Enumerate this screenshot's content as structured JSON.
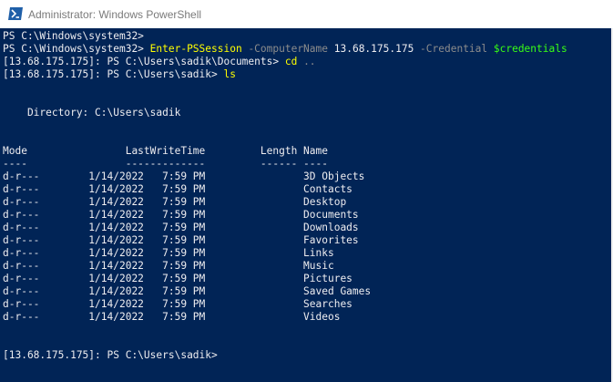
{
  "window": {
    "title": "Administrator: Windows PowerShell"
  },
  "console": {
    "lines": [
      {
        "segments": [
          {
            "text": "PS C:\\Windows\\system32>",
            "color": "white"
          }
        ]
      },
      {
        "segments": [
          {
            "text": "PS C:\\Windows\\system32> ",
            "color": "white"
          },
          {
            "text": "Enter-PSSession",
            "color": "yellow"
          },
          {
            "text": " -ComputerName ",
            "color": "gray"
          },
          {
            "text": "13.68.175.175",
            "color": "white"
          },
          {
            "text": " -Credential ",
            "color": "gray"
          },
          {
            "text": "$credentials",
            "color": "green"
          }
        ]
      },
      {
        "segments": [
          {
            "text": "[13.68.175.175]: PS C:\\Users\\sadik\\Documents> ",
            "color": "white"
          },
          {
            "text": "cd",
            "color": "yellow"
          },
          {
            "text": " ..",
            "color": "gray"
          }
        ]
      },
      {
        "segments": [
          {
            "text": "[13.68.175.175]: PS C:\\Users\\sadik> ",
            "color": "white"
          },
          {
            "text": "ls",
            "color": "yellow"
          }
        ]
      },
      {
        "segments": []
      },
      {
        "segments": []
      },
      {
        "segments": [
          {
            "text": "    Directory: C:\\Users\\sadik",
            "color": "white"
          }
        ]
      },
      {
        "segments": []
      },
      {
        "segments": []
      },
      {
        "segments": [
          {
            "text": "Mode                LastWriteTime         Length Name",
            "color": "white"
          }
        ]
      },
      {
        "segments": [
          {
            "text": "----                -------------         ------ ----",
            "color": "white"
          }
        ]
      },
      {
        "segments": [
          {
            "text": "d-r---        1/14/2022   7:59 PM                3D Objects",
            "color": "white"
          }
        ]
      },
      {
        "segments": [
          {
            "text": "d-r---        1/14/2022   7:59 PM                Contacts",
            "color": "white"
          }
        ]
      },
      {
        "segments": [
          {
            "text": "d-r---        1/14/2022   7:59 PM                Desktop",
            "color": "white"
          }
        ]
      },
      {
        "segments": [
          {
            "text": "d-r---        1/14/2022   7:59 PM                Documents",
            "color": "white"
          }
        ]
      },
      {
        "segments": [
          {
            "text": "d-r---        1/14/2022   7:59 PM                Downloads",
            "color": "white"
          }
        ]
      },
      {
        "segments": [
          {
            "text": "d-r---        1/14/2022   7:59 PM                Favorites",
            "color": "white"
          }
        ]
      },
      {
        "segments": [
          {
            "text": "d-r---        1/14/2022   7:59 PM                Links",
            "color": "white"
          }
        ]
      },
      {
        "segments": [
          {
            "text": "d-r---        1/14/2022   7:59 PM                Music",
            "color": "white"
          }
        ]
      },
      {
        "segments": [
          {
            "text": "d-r---        1/14/2022   7:59 PM                Pictures",
            "color": "white"
          }
        ]
      },
      {
        "segments": [
          {
            "text": "d-r---        1/14/2022   7:59 PM                Saved Games",
            "color": "white"
          }
        ]
      },
      {
        "segments": [
          {
            "text": "d-r---        1/14/2022   7:59 PM                Searches",
            "color": "white"
          }
        ]
      },
      {
        "segments": [
          {
            "text": "d-r---        1/14/2022   7:59 PM                Videos",
            "color": "white"
          }
        ]
      },
      {
        "segments": []
      },
      {
        "segments": []
      },
      {
        "segments": [
          {
            "text": "[13.68.175.175]: PS C:\\Users\\sadik>",
            "color": "white"
          }
        ]
      }
    ]
  },
  "icons": {
    "app_icon": "powershell-icon"
  },
  "colors": {
    "console_background": "#012456",
    "text_white": "#eeedf0",
    "command_yellow": "#ffff00",
    "parameter_gray": "#8c8c8c",
    "variable_green": "#39ff14"
  }
}
